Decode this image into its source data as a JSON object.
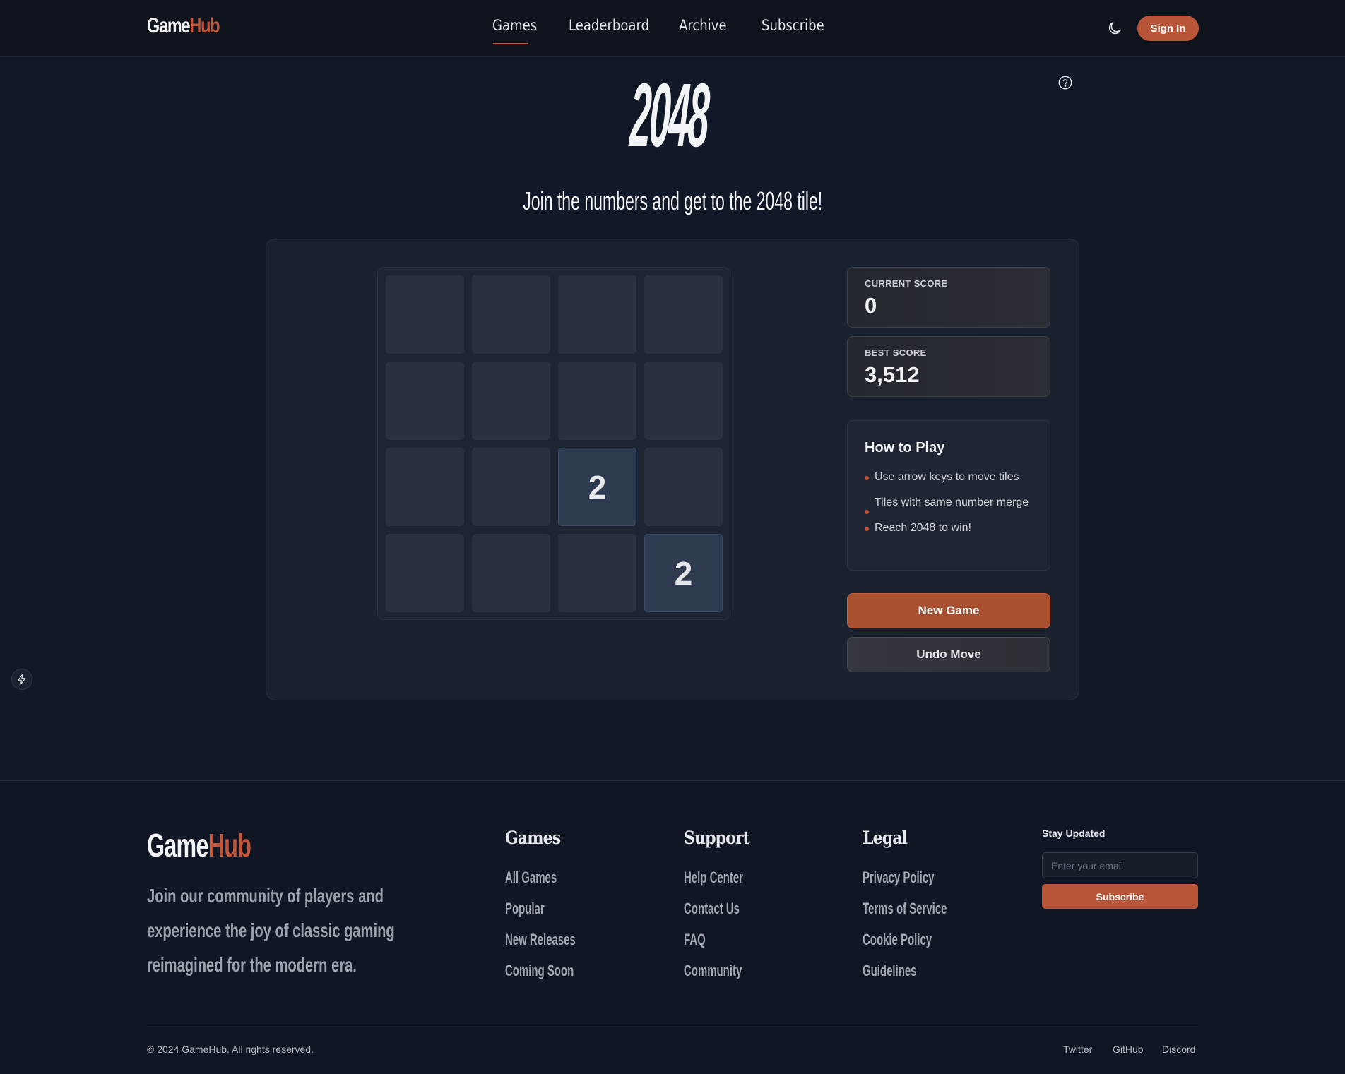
{
  "header": {
    "logo_part1": "Game",
    "logo_part2": "Hub",
    "nav": [
      "Games",
      "Leaderboard",
      "Archive",
      "Subscribe"
    ],
    "active_nav": "Games",
    "theme_icon": "moon-icon",
    "signin_label": "Sign In"
  },
  "title": {
    "game_name": "2048",
    "subtitle": "Join the numbers and get to the 2048 tile!",
    "help_icon": "question-circle-icon"
  },
  "board": {
    "size": 4,
    "rows": [
      [
        "",
        "",
        "",
        ""
      ],
      [
        "",
        "",
        "",
        ""
      ],
      [
        "",
        "",
        "2",
        ""
      ],
      [
        "",
        "",
        "",
        "2"
      ]
    ]
  },
  "scores": {
    "current_label": "CURRENT SCORE",
    "current_value": "0",
    "best_label": "BEST SCORE",
    "best_value": "3,512"
  },
  "how_to_play": {
    "title": "How to Play",
    "items": [
      "Use arrow keys to move tiles",
      "Tiles with same number merge",
      "Reach 2048 to win!"
    ]
  },
  "actions": {
    "new_game": "New Game",
    "undo": "Undo Move"
  },
  "side_icons": [
    "bolt-icon",
    "bolt-icon"
  ],
  "footer": {
    "logo_part1": "Game",
    "logo_part2": "Hub",
    "tagline": "Join our community of players and experience the joy of classic gaming reimagined for the modern era.",
    "columns": [
      {
        "title": "Games",
        "links": [
          "All Games",
          "Popular",
          "New Releases",
          "Coming Soon"
        ]
      },
      {
        "title": "Support",
        "links": [
          "Help Center",
          "Contact Us",
          "FAQ",
          "Community"
        ]
      },
      {
        "title": "Legal",
        "links": [
          "Privacy Policy",
          "Terms of Service",
          "Cookie Policy",
          "Guidelines"
        ]
      }
    ],
    "newsletter": {
      "title": "Stay Updated",
      "placeholder": "Enter your email",
      "button": "Subscribe"
    },
    "copyright": "© 2024 GameHub. All rights reserved.",
    "social": [
      "Twitter",
      "GitHub",
      "Discord"
    ]
  },
  "colors": {
    "accent": "#c2573b",
    "background": "#111827",
    "panel": "#1a2230"
  }
}
